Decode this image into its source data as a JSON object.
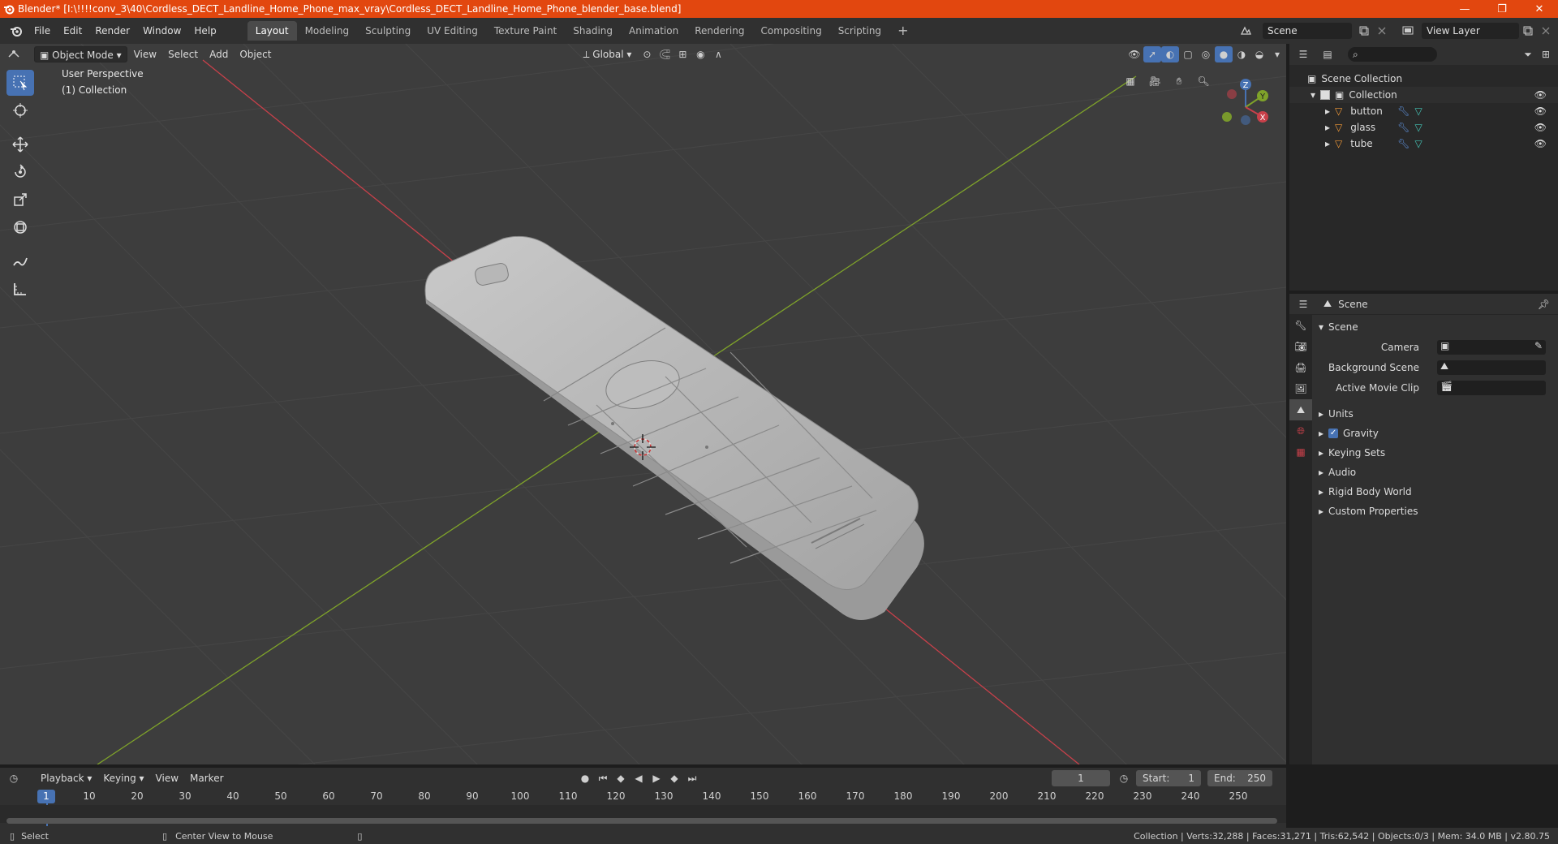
{
  "window": {
    "title": "Blender* [I:\\!!!!conv_3\\40\\Cordless_DECT_Landline_Home_Phone_max_vray\\Cordless_DECT_Landline_Home_Phone_blender_base.blend]",
    "minimize": "—",
    "restore": "❐",
    "close": "✕"
  },
  "menu": {
    "file": "File",
    "edit": "Edit",
    "render": "Render",
    "window": "Window",
    "help": "Help"
  },
  "workspaces": [
    "Layout",
    "Modeling",
    "Sculpting",
    "UV Editing",
    "Texture Paint",
    "Shading",
    "Animation",
    "Rendering",
    "Compositing",
    "Scripting"
  ],
  "workspace_add": "+",
  "scene_name": "Scene",
  "view_layer": "View Layer",
  "viewport": {
    "mode": "Object Mode",
    "view": "View",
    "select": "Select",
    "add": "Add",
    "object": "Object",
    "transform_orientation": "Global",
    "perspective_label": "User Perspective",
    "collection_label": "(1) Collection",
    "gizmo": {
      "z": "Z",
      "y": "Y",
      "x": "X"
    }
  },
  "outliner": {
    "root": "Scene Collection",
    "collection": "Collection",
    "objects": [
      "button",
      "glass",
      "tube"
    ]
  },
  "properties": {
    "header": "Scene",
    "panel": "Scene",
    "camera_label": "Camera",
    "background_scene_label": "Background Scene",
    "active_clip_label": "Active Movie Clip",
    "subpanels": [
      "Units",
      "Gravity",
      "Keying Sets",
      "Audio",
      "Rigid Body World",
      "Custom Properties"
    ]
  },
  "timeline": {
    "playback": "Playback",
    "keying": "Keying",
    "view": "View",
    "marker": "Marker",
    "current_frame": "1",
    "start_label": "Start:",
    "start": "1",
    "end_label": "End:",
    "end": "250",
    "ticks": [
      "1",
      "10",
      "20",
      "30",
      "40",
      "50",
      "60",
      "70",
      "80",
      "90",
      "100",
      "110",
      "120",
      "130",
      "140",
      "150",
      "160",
      "170",
      "180",
      "190",
      "200",
      "210",
      "220",
      "230",
      "240",
      "250"
    ]
  },
  "status": {
    "select": "Select",
    "center_view": "Center View to Mouse",
    "stats": "Collection | Verts:32,288 | Faces:31,271 | Tris:62,542 | Objects:0/3 | Mem: 34.0 MB | v2.80.75"
  },
  "colors": {
    "title_bar": "#e2470f",
    "accent_blue": "#4772b3",
    "x_axis": "#c8404a",
    "y_axis": "#7fa32a"
  }
}
